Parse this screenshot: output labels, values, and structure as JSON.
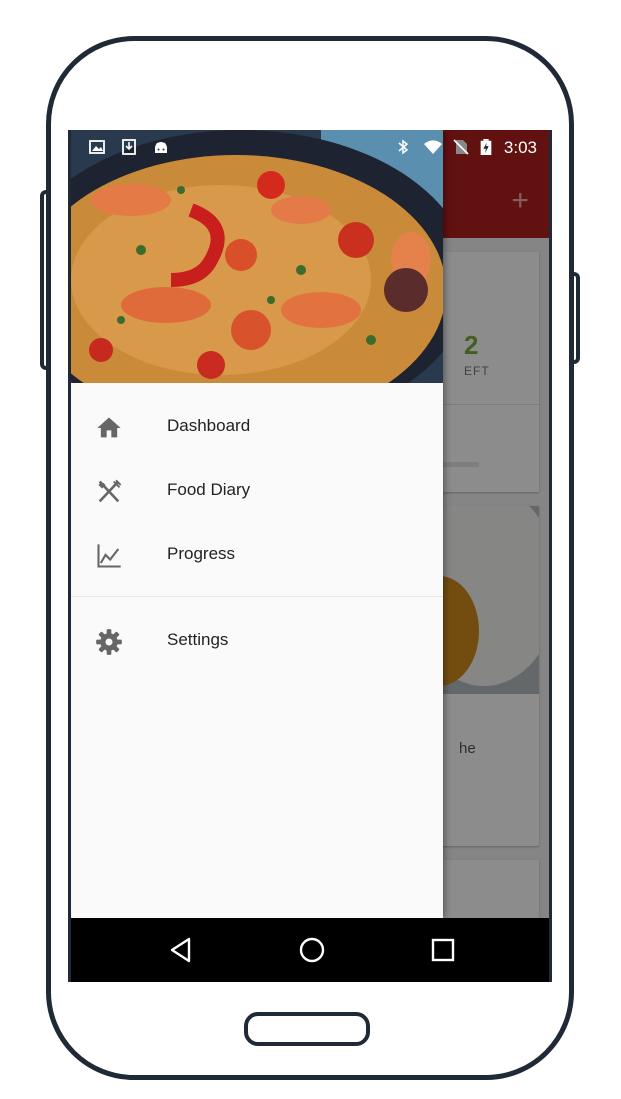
{
  "status_bar": {
    "time": "3:03",
    "icons": [
      "image-icon",
      "download-icon",
      "android-icon",
      "bluetooth-icon",
      "wifi-icon",
      "no-sim-icon",
      "battery-charging-icon"
    ]
  },
  "background_app": {
    "accent_color": "#b3201f",
    "add_icon": "plus-icon",
    "calories_left_value": "2",
    "calories_left_caption": "EFT",
    "card_text_fragment": "he"
  },
  "drawer": {
    "header_image": "paella-photo",
    "items": [
      {
        "label": "Dashboard",
        "icon": "home-icon"
      },
      {
        "label": "Food Diary",
        "icon": "fork-knife-icon"
      },
      {
        "label": "Progress",
        "icon": "chart-icon"
      }
    ],
    "secondary_items": [
      {
        "label": "Settings",
        "icon": "gear-icon"
      }
    ]
  },
  "nav_bar": {
    "buttons": [
      "back-icon",
      "home-circle-icon",
      "recents-icon"
    ]
  }
}
